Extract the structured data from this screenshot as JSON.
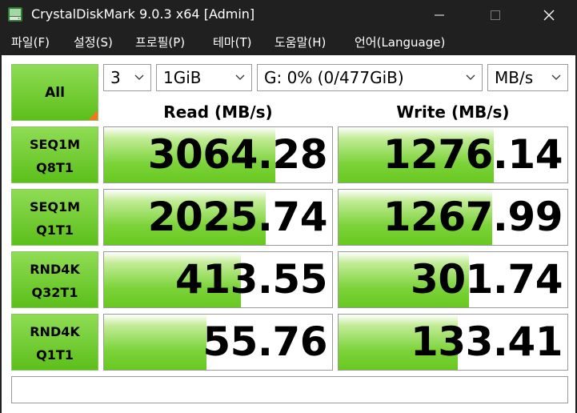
{
  "window": {
    "title": "CrystalDiskMark 9.0.3 x64 [Admin]"
  },
  "menu": [
    {
      "label": "파일(F)"
    },
    {
      "label": "설정(S)"
    },
    {
      "label": "프로필(P)"
    },
    {
      "label": "테마(T)"
    },
    {
      "label": "도움말(H)"
    },
    {
      "label": "언어(Language)"
    }
  ],
  "controls": {
    "all_label": "All",
    "count": "3",
    "size": "1GiB",
    "drive": "G: 0% (0/477GiB)",
    "unit": "MB/s"
  },
  "headers": {
    "read": "Read (MB/s)",
    "write": "Write (MB/s)"
  },
  "tests": [
    {
      "line1": "SEQ1M",
      "line2": "Q8T1",
      "read": "3064.28",
      "write": "1276.14",
      "read_fill": 0.75,
      "write_fill": 0.68
    },
    {
      "line1": "SEQ1M",
      "line2": "Q1T1",
      "read": "2025.74",
      "write": "1267.99",
      "read_fill": 0.71,
      "write_fill": 0.67
    },
    {
      "line1": "RND4K",
      "line2": "Q32T1",
      "read": "413.55",
      "write": "301.74",
      "read_fill": 0.6,
      "write_fill": 0.57
    },
    {
      "line1": "RND4K",
      "line2": "Q1T1",
      "read": "55.76",
      "write": "133.41",
      "read_fill": 0.45,
      "write_fill": 0.52
    }
  ],
  "comment": "",
  "colors": {
    "accent_green": "#5cbf1a",
    "corner_orange": "#f0781e",
    "titlebar": "#202020"
  },
  "icons": {
    "app": "crystaldiskmark-app-icon",
    "minimize": "minimize-icon",
    "maximize": "maximize-icon",
    "close": "close-icon",
    "dropdown": "chevron-down-icon"
  }
}
